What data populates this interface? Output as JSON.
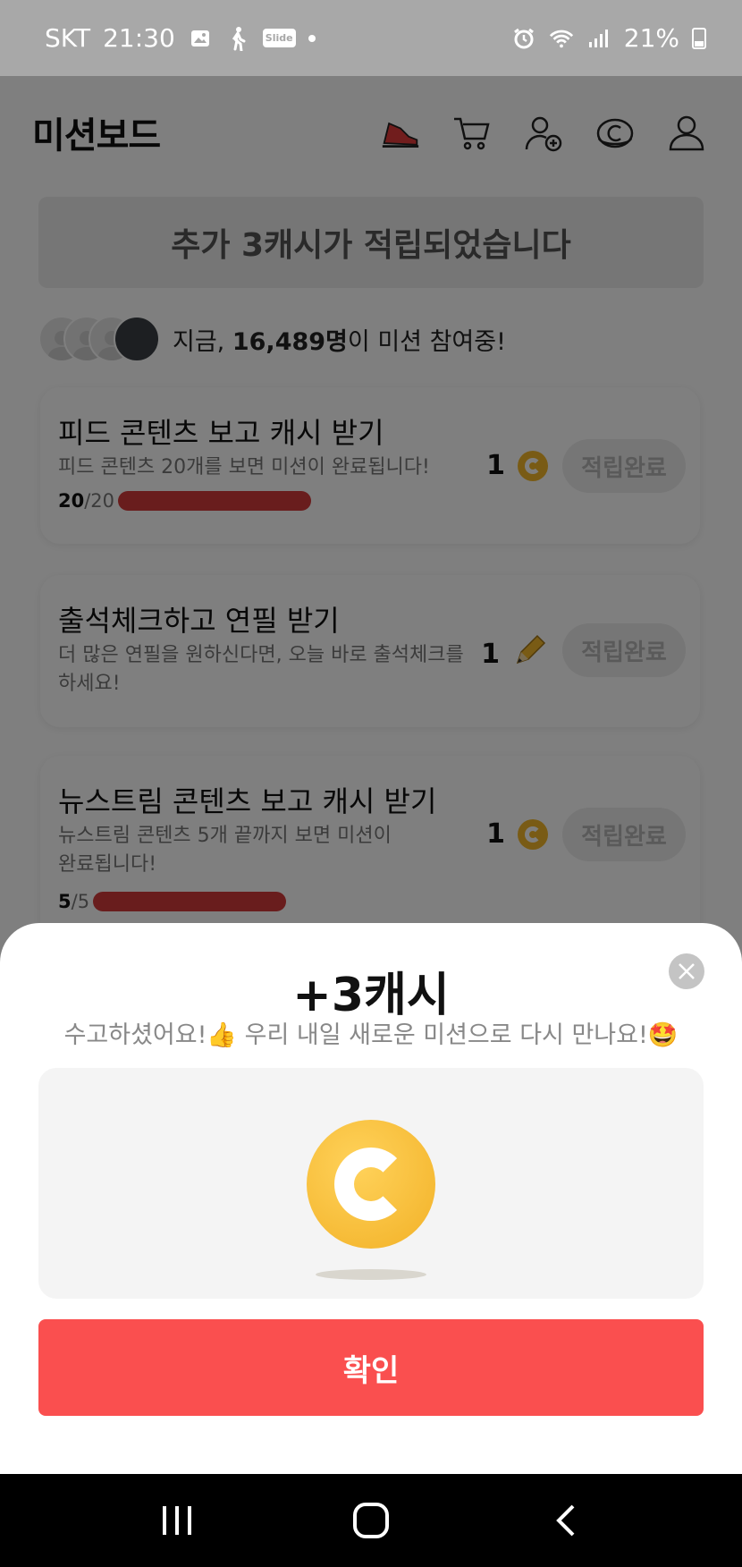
{
  "status_bar": {
    "carrier": "SKT",
    "time": "21:30",
    "slide_badge": "Slide",
    "battery": "21%"
  },
  "header": {
    "title": "미션보드"
  },
  "notice": {
    "text": "추가 3캐시가 적립되었습니다"
  },
  "participants": {
    "prefix": "지금, ",
    "count": "16,489명",
    "suffix": "이 미션 참여중!"
  },
  "missions": [
    {
      "title": "피드 콘텐츠 보고 캐시 받기",
      "desc": "피드 콘텐츠 20개를 보면 미션이 완료됩니다!",
      "progress_done": "20",
      "progress_total": "/20",
      "progress_fraction": 1.0,
      "reward_amount": "1",
      "reward_icon": "cash-coin-icon",
      "button": "적립완료"
    },
    {
      "title": "출석체크하고 연필 받기",
      "desc": "더 많은 연필을 원하신다면, 오늘 바로 출석체크를 하세요!",
      "reward_amount": "1",
      "reward_icon": "pencil-icon",
      "button": "적립완료"
    },
    {
      "title": "뉴스트림 콘텐츠 보고 캐시 받기",
      "desc": "뉴스트림 콘텐츠 5개 끝까지 보면 미션이 완료됩니다!",
      "progress_done": "5",
      "progress_total": "/5",
      "progress_fraction": 1.0,
      "reward_amount": "1",
      "reward_icon": "cash-coin-icon",
      "button": "적립완료"
    }
  ],
  "sheet": {
    "title": "+3캐시",
    "message": "수고하셨어요!👍 우리 내일 새로운 미션으로 다시 만나요!🤩",
    "confirm": "확인"
  },
  "colors": {
    "accent_red": "#fa4f4f",
    "progress_red": "#d23a3a",
    "coin_gold": "#f3b72a"
  }
}
